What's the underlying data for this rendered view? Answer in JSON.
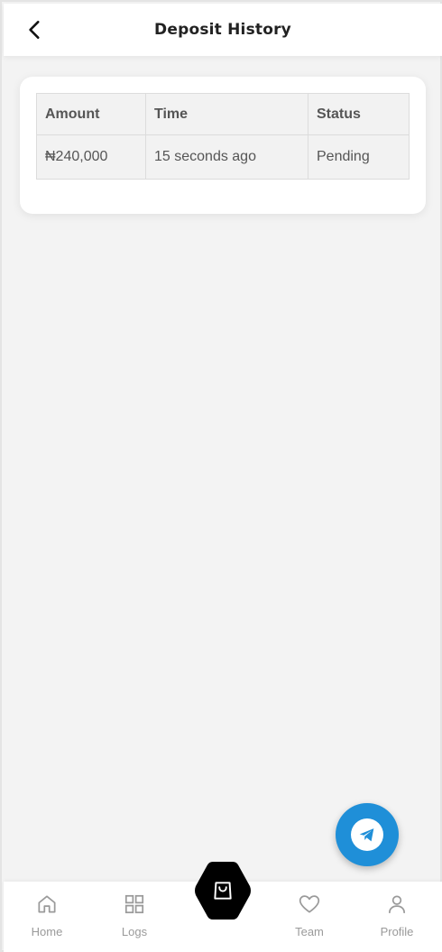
{
  "header": {
    "title": "Deposit History",
    "back_icon": "chevron-left-icon"
  },
  "table": {
    "headers": [
      "Amount",
      "Time",
      "Status"
    ],
    "rows": [
      {
        "amount": "₦240,000",
        "time": "15 seconds ago",
        "status": "Pending"
      }
    ]
  },
  "colors": {
    "pending": "#f4a43a",
    "fab": "#1f8fd8",
    "shop_button": "#000000",
    "nav_inactive": "#9a9a9a"
  },
  "fab": {
    "icon": "telegram-icon"
  },
  "bottom_nav": {
    "items": [
      {
        "label": "Home",
        "icon": "home-icon"
      },
      {
        "label": "Logs",
        "icon": "grid-icon"
      },
      {
        "label": "",
        "icon": "shopping-bag-icon"
      },
      {
        "label": "Team",
        "icon": "heart-icon"
      },
      {
        "label": "Profile",
        "icon": "user-icon"
      }
    ]
  }
}
